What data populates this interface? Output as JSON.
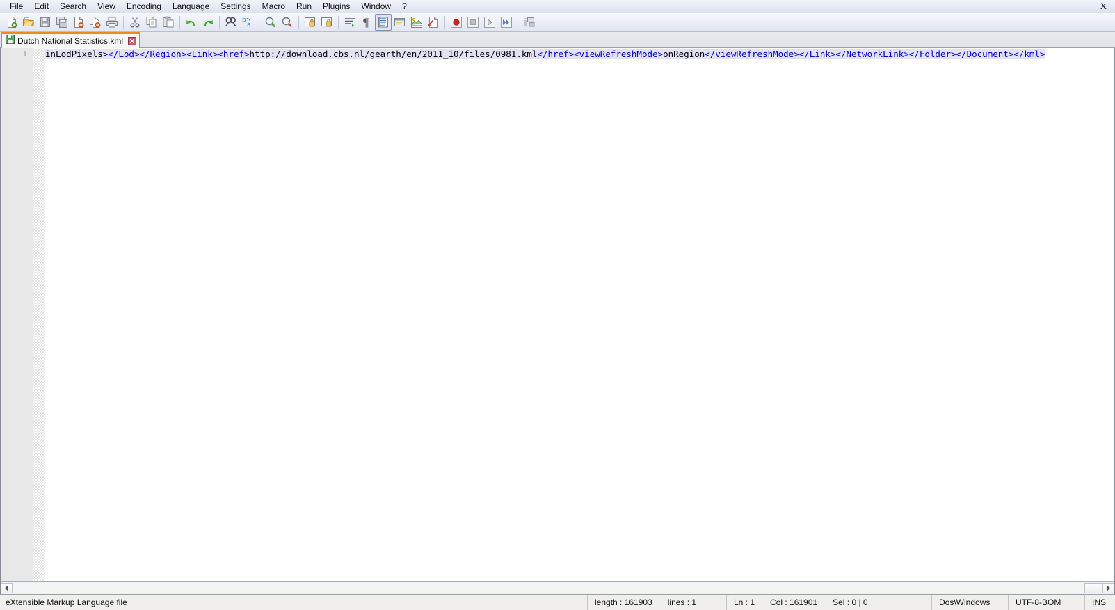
{
  "menu": {
    "items": [
      {
        "label": "File"
      },
      {
        "label": "Edit"
      },
      {
        "label": "Search"
      },
      {
        "label": "View"
      },
      {
        "label": "Encoding"
      },
      {
        "label": "Language"
      },
      {
        "label": "Settings"
      },
      {
        "label": "Macro"
      },
      {
        "label": "Run"
      },
      {
        "label": "Plugins"
      },
      {
        "label": "Window"
      },
      {
        "label": "?"
      }
    ],
    "close_label": "X"
  },
  "toolbar": {
    "buttons": [
      {
        "name": "new-file-icon",
        "title": "New"
      },
      {
        "name": "open-folder-icon",
        "title": "Open"
      },
      {
        "name": "save-icon",
        "title": "Save"
      },
      {
        "name": "save-all-icon",
        "title": "Save All"
      },
      {
        "name": "close-file-icon",
        "title": "Close"
      },
      {
        "name": "close-all-icon",
        "title": "Close All"
      },
      {
        "name": "print-icon",
        "title": "Print"
      },
      {
        "name": "cut-icon",
        "title": "Cut"
      },
      {
        "name": "copy-icon",
        "title": "Copy"
      },
      {
        "name": "paste-icon",
        "title": "Paste"
      },
      {
        "name": "undo-icon",
        "title": "Undo"
      },
      {
        "name": "redo-icon",
        "title": "Redo"
      },
      {
        "name": "find-icon",
        "title": "Find"
      },
      {
        "name": "replace-icon",
        "title": "Replace"
      },
      {
        "name": "zoom-in-icon",
        "title": "Zoom In"
      },
      {
        "name": "zoom-out-icon",
        "title": "Zoom Out"
      },
      {
        "name": "sync-vertical-scroll-icon",
        "title": "Synchronize Vertical Scrolling"
      },
      {
        "name": "sync-horizontal-scroll-icon",
        "title": "Synchronize Horizontal Scrolling"
      },
      {
        "name": "word-wrap-icon",
        "title": "Word Wrap"
      },
      {
        "name": "show-all-characters-icon",
        "title": "Show All Characters"
      },
      {
        "name": "indent-guide-icon",
        "title": "Show Indent Guide"
      },
      {
        "name": "user-defined-dialog-icon",
        "title": "User Defined Dialogue"
      },
      {
        "name": "document-map-icon",
        "title": "Document Map"
      },
      {
        "name": "function-list-icon",
        "title": "Function List"
      },
      {
        "name": "macro-record-icon",
        "title": "Start Recording"
      },
      {
        "name": "macro-stop-icon",
        "title": "Stop Recording"
      },
      {
        "name": "macro-play-icon",
        "title": "Playback"
      },
      {
        "name": "macro-run-multiple-icon",
        "title": "Run a Macro Multiple Times"
      },
      {
        "name": "folder-as-workspace-icon",
        "title": "Folder as Workspace"
      }
    ]
  },
  "tabs": [
    {
      "label": "Dutch National Statistics.kml",
      "icon": "saved-document-icon",
      "active": true
    }
  ],
  "editor": {
    "line_numbers": [
      "1"
    ],
    "line_1_segments": [
      {
        "type": "txt",
        "text": "inLodPixels"
      },
      {
        "type": "tag",
        "text": "></Lod></Region><Link><href>"
      },
      {
        "type": "url",
        "text": "http://download.cbs.nl/gearth/en/2011_10/files/0981.kml"
      },
      {
        "type": "tag",
        "text": "</href><viewRefreshMode>"
      },
      {
        "type": "txt",
        "text": "onRegion"
      },
      {
        "type": "tag",
        "text": "</viewRefreshMode></Link></NetworkLink></Folder></Document></kml>"
      }
    ],
    "colors": {
      "tag": "#0000d0",
      "text": "#000000",
      "selection": "#e3e1f4",
      "gutter_bg": "#e8e8e8",
      "linenum": "#9a9a9a"
    }
  },
  "statusbar": {
    "file_type": "eXtensible Markup Language file",
    "length_label": "length : 161903",
    "lines_label": "lines : 1",
    "ln_label": "Ln : 1",
    "col_label": "Col : 161901",
    "sel_label": "Sel : 0 | 0",
    "eol_format": "Dos\\Windows",
    "encoding": "UTF-8-BOM",
    "insert_mode": "INS"
  },
  "scrollbar": {
    "left_arrow": "◄",
    "right_arrow": "►"
  }
}
